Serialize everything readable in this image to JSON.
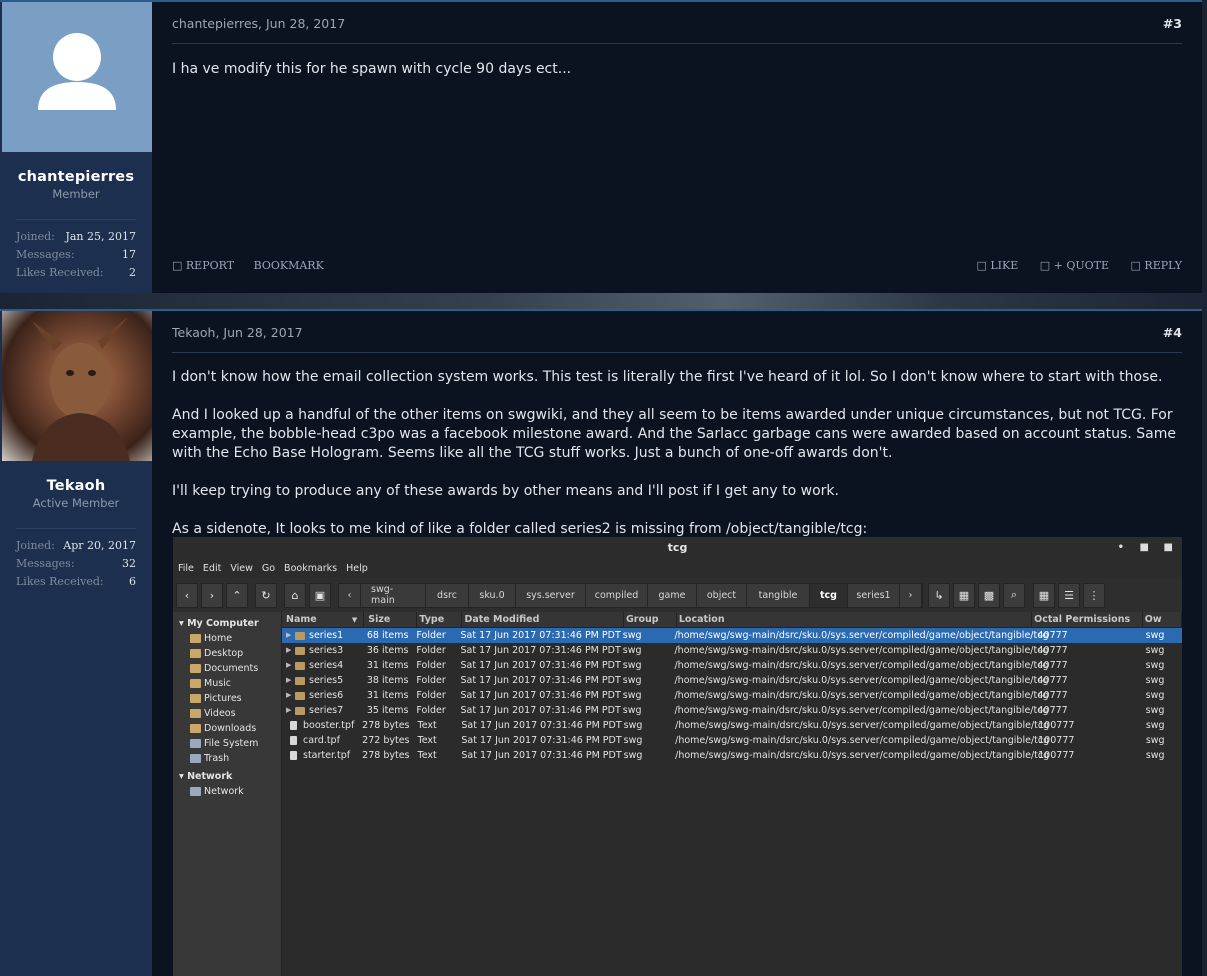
{
  "posts": [
    {
      "author": "chantepierres",
      "role": "Member",
      "stats": [
        {
          "label": "Joined:",
          "value": "Jan 25, 2017"
        },
        {
          "label": "Messages:",
          "value": "17"
        },
        {
          "label": "Likes Received:",
          "value": "2"
        }
      ],
      "header": "chantepierres, Jun 28, 2017",
      "number": "#3",
      "body": [
        "I ha ve modify this for he spawn with cycle 90 days ect..."
      ],
      "actions_left": [
        "REPORT",
        "BOOKMARK"
      ],
      "actions_right": [
        "LIKE",
        "+ QUOTE",
        "REPLY"
      ]
    },
    {
      "author": "Tekaoh",
      "role": "Active Member",
      "stats": [
        {
          "label": "Joined:",
          "value": "Apr 20, 2017"
        },
        {
          "label": "Messages:",
          "value": "32"
        },
        {
          "label": "Likes Received:",
          "value": "6"
        }
      ],
      "header": "Tekaoh, Jun 28, 2017",
      "number": "#4",
      "body": [
        "I don't know how the email collection system works. This test is literally the first I've heard of it lol. So I don't know where to start with those.",
        "And I looked up a handful of the other items on swgwiki, and they all seem to be items awarded under unique circumstances, but not TCG. For example, the bobble-head c3po was a facebook milestone award. And the Sarlacc garbage cans were awarded based on account status. Same with the Echo Base Hologram. Seems like all the TCG stuff works. Just a bunch of one-off awards don't.",
        "I'll keep trying to produce any of these awards by other means and I'll post if I get any to work.",
        "As a sidenote, It looks to me kind of like a folder called series2 is missing from /object/tangible/tcg:"
      ]
    }
  ],
  "file_manager": {
    "title": "tcg",
    "menu": [
      "File",
      "Edit",
      "View",
      "Go",
      "Bookmarks",
      "Help"
    ],
    "breadcrumbs": [
      "swg-main",
      "dsrc",
      "sku.0",
      "sys.server",
      "compiled",
      "game",
      "object",
      "tangible",
      "tcg",
      "series1"
    ],
    "current_crumb": "tcg",
    "sidebar": {
      "my_computer": "My Computer",
      "places": [
        "Home",
        "Desktop",
        "Documents",
        "Music",
        "Pictures",
        "Videos",
        "Downloads",
        "File System",
        "Trash"
      ],
      "network_header": "Network",
      "network_items": [
        "Network"
      ]
    },
    "columns": [
      "Name",
      "Size",
      "Type",
      "Date Modified",
      "Group",
      "Location",
      "Octal Permissions",
      "Ow"
    ],
    "rows": [
      {
        "name": "series1",
        "size": "68 items",
        "type": "Folder",
        "date": "Sat 17 Jun 2017 07:31:46 PM PDT",
        "group": "swg",
        "location": "/home/swg/swg-main/dsrc/sku.0/sys.server/compiled/game/object/tangible/tcg",
        "octal": "40777",
        "owner": "swg",
        "folder": true,
        "selected": true
      },
      {
        "name": "series3",
        "size": "36 items",
        "type": "Folder",
        "date": "Sat 17 Jun 2017 07:31:46 PM PDT",
        "group": "swg",
        "location": "/home/swg/swg-main/dsrc/sku.0/sys.server/compiled/game/object/tangible/tcg",
        "octal": "40777",
        "owner": "swg",
        "folder": true
      },
      {
        "name": "series4",
        "size": "31 items",
        "type": "Folder",
        "date": "Sat 17 Jun 2017 07:31:46 PM PDT",
        "group": "swg",
        "location": "/home/swg/swg-main/dsrc/sku.0/sys.server/compiled/game/object/tangible/tcg",
        "octal": "40777",
        "owner": "swg",
        "folder": true
      },
      {
        "name": "series5",
        "size": "38 items",
        "type": "Folder",
        "date": "Sat 17 Jun 2017 07:31:46 PM PDT",
        "group": "swg",
        "location": "/home/swg/swg-main/dsrc/sku.0/sys.server/compiled/game/object/tangible/tcg",
        "octal": "40777",
        "owner": "swg",
        "folder": true
      },
      {
        "name": "series6",
        "size": "31 items",
        "type": "Folder",
        "date": "Sat 17 Jun 2017 07:31:46 PM PDT",
        "group": "swg",
        "location": "/home/swg/swg-main/dsrc/sku.0/sys.server/compiled/game/object/tangible/tcg",
        "octal": "40777",
        "owner": "swg",
        "folder": true
      },
      {
        "name": "series7",
        "size": "35 items",
        "type": "Folder",
        "date": "Sat 17 Jun 2017 07:31:46 PM PDT",
        "group": "swg",
        "location": "/home/swg/swg-main/dsrc/sku.0/sys.server/compiled/game/object/tangible/tcg",
        "octal": "40777",
        "owner": "swg",
        "folder": true
      },
      {
        "name": "booster.tpf",
        "size": "278 bytes",
        "type": "Text",
        "date": "Sat 17 Jun 2017 07:31:46 PM PDT",
        "group": "swg",
        "location": "/home/swg/swg-main/dsrc/sku.0/sys.server/compiled/game/object/tangible/tcg",
        "octal": "100777",
        "owner": "swg",
        "folder": false
      },
      {
        "name": "card.tpf",
        "size": "272 bytes",
        "type": "Text",
        "date": "Sat 17 Jun 2017 07:31:46 PM PDT",
        "group": "swg",
        "location": "/home/swg/swg-main/dsrc/sku.0/sys.server/compiled/game/object/tangible/tcg",
        "octal": "100777",
        "owner": "swg",
        "folder": false
      },
      {
        "name": "starter.tpf",
        "size": "278 bytes",
        "type": "Text",
        "date": "Sat 17 Jun 2017 07:31:46 PM PDT",
        "group": "swg",
        "location": "/home/swg/swg-main/dsrc/sku.0/sys.server/compiled/game/object/tangible/tcg",
        "octal": "100777",
        "owner": "swg",
        "folder": false
      }
    ]
  },
  "colors": {
    "accent": "#2b5d8a",
    "user_panel": "#1c2f4e",
    "content_bg": "#0b1220",
    "selection": "#2b69b0"
  }
}
